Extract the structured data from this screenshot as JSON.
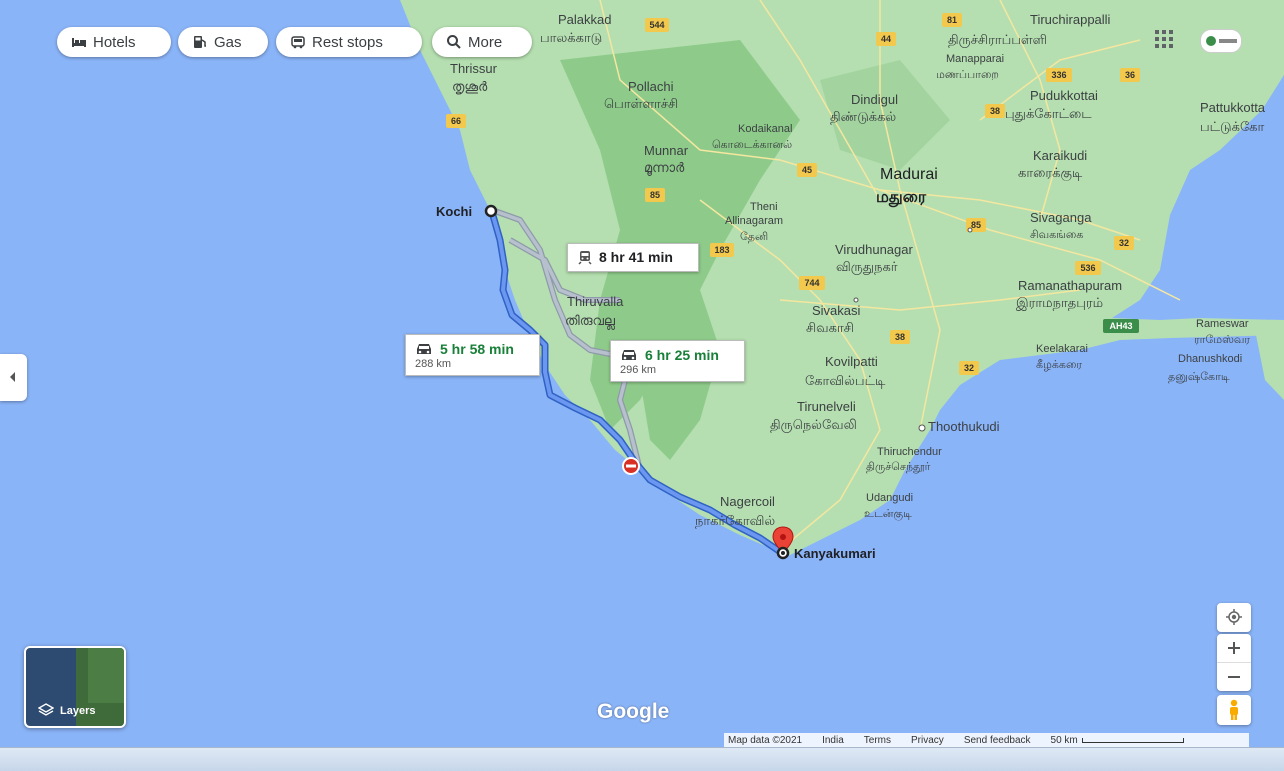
{
  "chips": {
    "hotels": "Hotels",
    "gas": "Gas",
    "rest_stops": "Rest stops",
    "more": "More"
  },
  "routes": {
    "primary": {
      "time": "5 hr 58 min",
      "distance": "288 km"
    },
    "alternate": {
      "time": "6 hr 25 min",
      "distance": "296 km"
    },
    "transit": {
      "time": "8 hr 41 min"
    }
  },
  "endpoints": {
    "origin": "Kochi",
    "destination": "Kanyakumari"
  },
  "places": {
    "palakkad": "Palakkad",
    "palakkad_ta": "பாலக்காடு",
    "thrissur": "Thrissur",
    "thrissur_ml": "തൃശൂർ",
    "pollachi": "Pollachi",
    "pollachi_ta": "பொள்ளாச்சி",
    "tiruchirappalli": "Tiruchirappalli",
    "tiruchirappalli_ta": "திருச்சிராப்பள்ளி",
    "manapparai": "Manapparai",
    "manapparai_ta": "மணப்பாறை",
    "dindigul": "Dindigul",
    "dindigul_ta": "திண்டுக்கல்",
    "pudukkottai": "Pudukkottai",
    "pudukkottai_ta": "புதுக்கோட்டை",
    "pattukkottai": "Pattukkotta",
    "pattukkottai_ta": "பட்டுக்கோ",
    "kodaikanal": "Kodaikanal",
    "kodaikanal_ta": "கொடைக்கானல்",
    "munnar": "Munnar",
    "munnar_ml": "മൂന്നാർ",
    "madurai": "Madurai",
    "madurai_ta": "மதுரை",
    "karaikudi": "Karaikudi",
    "karaikudi_ta": "காரைக்குடி",
    "theni": "Theni",
    "theni_ta": "தேனி",
    "allinagaram": "Allinagaram",
    "sivaganga": "Sivaganga",
    "sivaganga_ta": "சிவகங்கை",
    "virudhunagar": "Virudhunagar",
    "virudhunagar_ta": "விருதுநகர்",
    "ramanathapuram": "Ramanathapuram",
    "ramanathapuram_ta": "இராமநாதபுரம்",
    "thiruvalla": "Thiruvalla",
    "thiruvalla_ml": "തിരുവല്ല",
    "sivakasi": "Sivakasi",
    "sivakasi_ta": "சிவகாசி",
    "rameswaram": "Rameswar",
    "rameswaram_ta": "ராமேஸ்வர",
    "keelakarai": "Keelakarai",
    "keelakarai_ta": "கீழக்கரை",
    "dhanushkodi": "Dhanushkodi",
    "dhanushkodi_ta": "தனுஷ்கோடி",
    "kovilpatti": "Kovilpatti",
    "kovilpatti_ta": "கோவில்பட்டி",
    "tirunelveli": "Tirunelveli",
    "tirunelveli_ta": "திருநெல்வேலி",
    "thoothukudi": "Thoothukudi",
    "thiruchendur": "Thiruchendur",
    "thiruchendur_ta": "திருச்செந்தூர்",
    "udangudi": "Udangudi",
    "udangudi_ta": "உடன்குடி",
    "nagercoil": "Nagercoil",
    "nagercoil_ta": "நாகர்கோவில்"
  },
  "shields": [
    "544",
    "81",
    "44",
    "336",
    "36",
    "66",
    "38",
    "45",
    "85",
    "183",
    "744",
    "85",
    "32",
    "536",
    "AH43",
    "38",
    "32"
  ],
  "layers_label": "Layers",
  "google_logo": "Google",
  "footer": {
    "map_data": "Map data ©2021",
    "india": "India",
    "terms": "Terms",
    "privacy": "Privacy",
    "feedback": "Send feedback",
    "scale": "50 km"
  },
  "colors": {
    "water": "#8ab4f8",
    "land": "#aadaaa",
    "route_primary": "#4a7de8",
    "route_alt": "#a9b4c4",
    "pin": "#ea4335"
  }
}
